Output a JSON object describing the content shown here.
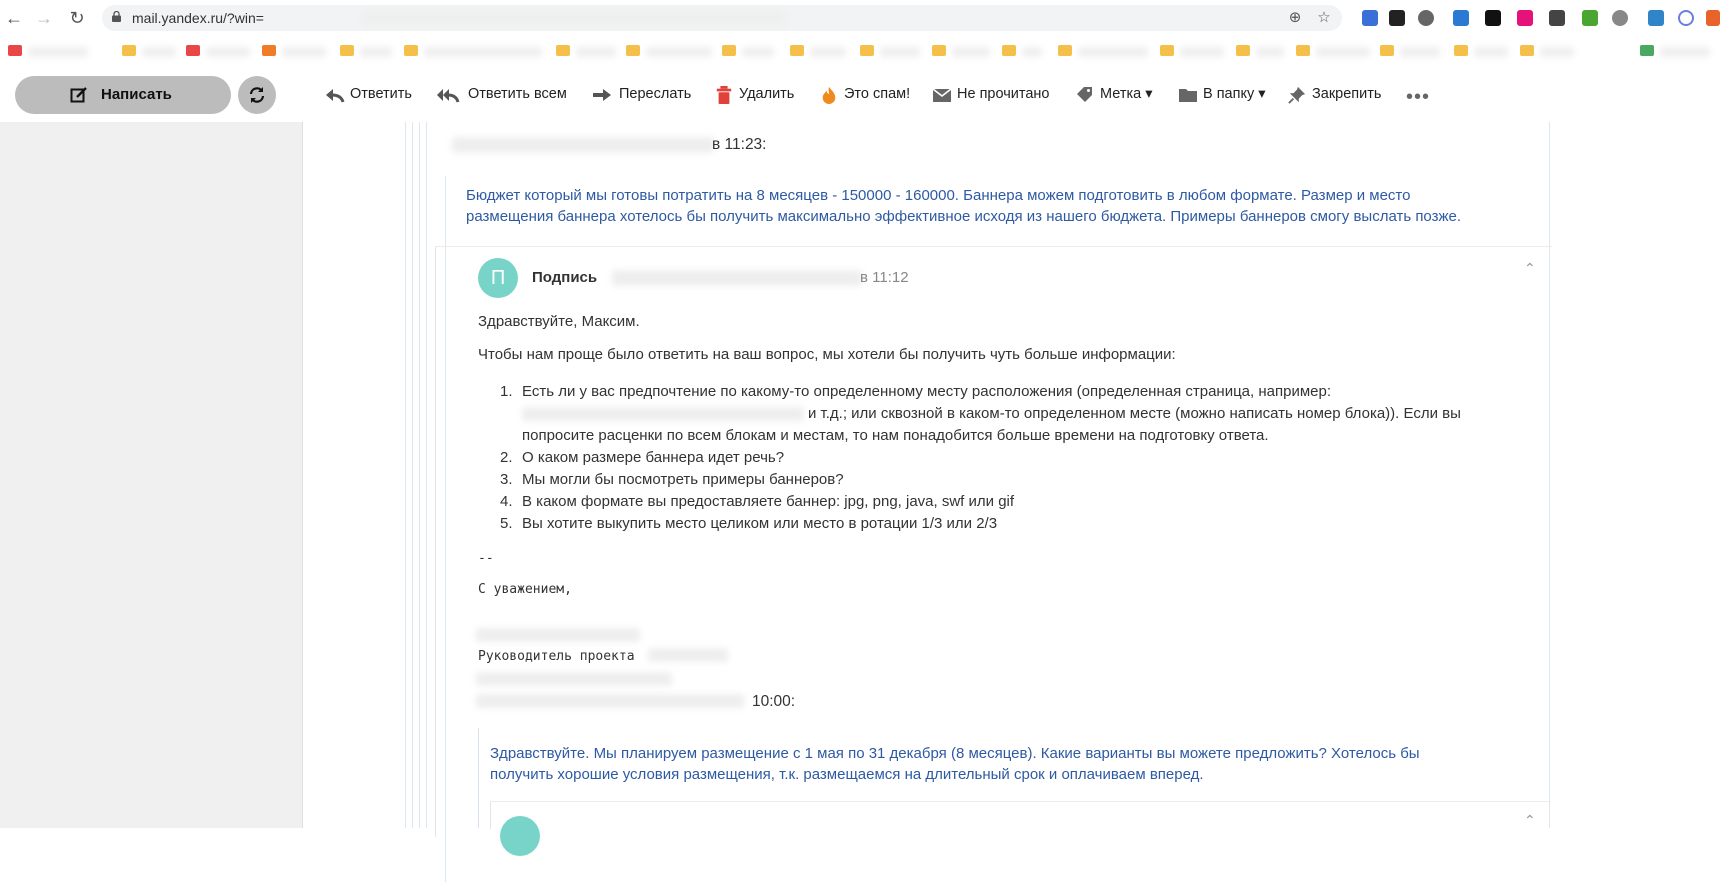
{
  "browser": {
    "url": "mail.yandex.ru/?win="
  },
  "toolbar": {
    "compose_label": "Написать",
    "actions": [
      {
        "label": "Ответить"
      },
      {
        "label": "Ответить всем"
      },
      {
        "label": "Переслать"
      },
      {
        "label": "Удалить"
      },
      {
        "label": "Это спам!"
      },
      {
        "label": "Не прочитано"
      },
      {
        "label": "Метка ▾"
      },
      {
        "label": "В папку ▾"
      },
      {
        "label": "Закрепить"
      }
    ],
    "more": "•••"
  },
  "thread": {
    "quote1_header_time": "в 11:23:",
    "quote1_text_line1": "Бюджет который мы готовы потратить на 8 месяцев - 150000 - 160000. Баннера можем подготовить в любом формате. Размер и место",
    "quote1_text_line2": "размещения баннера хотелось бы получить максимально эффективное исходя из нашего бюджета. Примеры баннеров смогу выслать позже.",
    "message": {
      "avatar_letter": "П",
      "sender": "Подпись",
      "time": "в 11:12",
      "greeting": "Здравствуйте, Максим.",
      "intro": "Чтобы нам проще было ответить на ваш вопрос, мы хотели бы получить чуть больше информации:",
      "item1_line1": "Есть ли у вас предпочтение по какому-то определенному месту расположения (определенная страница, например:",
      "item1_line2_tail": "и т.д.; или сквозной в каком-то определенном месте (можно написать номер блока)). Если вы",
      "item1_line3": "попросите расценки по всем блокам и местам, то нам понадобится больше времени на подготовку ответа.",
      "items": [
        {
          "num": "1.",
          "text": ""
        },
        {
          "num": "2.",
          "text": "О каком размере баннера идет речь?"
        },
        {
          "num": "3.",
          "text": "Мы могли бы посмотреть примеры баннеров?"
        },
        {
          "num": "4.",
          "text": "В каком формате вы предоставляете баннер: jpg, png, java, swf или gif"
        },
        {
          "num": "5.",
          "text": "Вы хотите выкупить место целиком или место в ротации 1/3 или 2/3"
        }
      ],
      "sig_dash": "--",
      "sig_regards": "С уважением,",
      "sig_role": "Руководитель проекта",
      "quoted_time": "10:00:",
      "quote2_line1": "Здравствуйте. Мы планируем размещение с 1 мая по 31 декабря (8 месяцев). Какие варианты вы можете предложить? Хотелось бы",
      "quote2_line2": "получить хорошие условия размещения, т.к. размещаемся на длительный срок и оплачиваем вперед."
    }
  },
  "colors": {
    "quote_text": "#2e5aa3",
    "avatar": "#78d4c8",
    "compose_bg": "#bcbcbc",
    "delete_icon": "#e0413a",
    "spam_icon": "#f08a1c"
  }
}
